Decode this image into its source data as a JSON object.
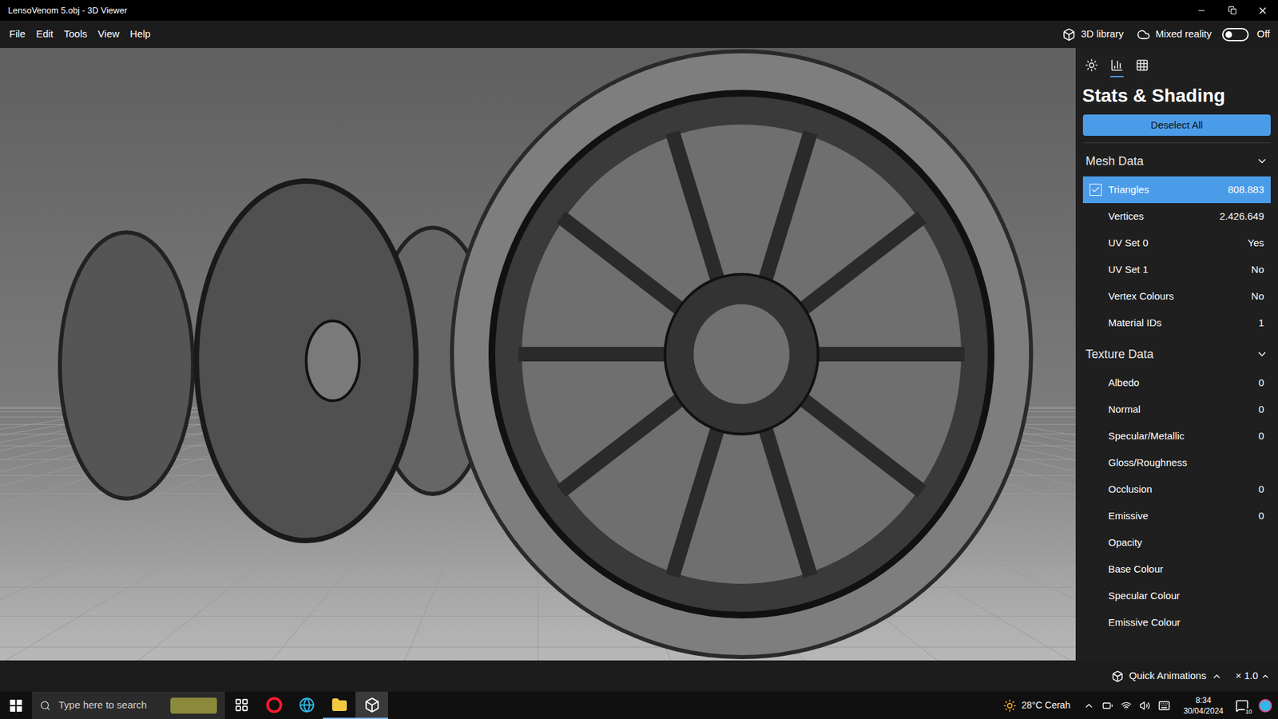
{
  "window": {
    "title": "LensoVenom 5.obj - 3D Viewer"
  },
  "menu": [
    "File",
    "Edit",
    "Tools",
    "View",
    "Help"
  ],
  "toolbar": {
    "library": "3D library",
    "mixed_reality": {
      "label": "Mixed reality",
      "on": false,
      "state_text": "Off"
    }
  },
  "panel": {
    "tabs": [
      {
        "name": "lighting",
        "selected": false
      },
      {
        "name": "stats",
        "selected": true
      },
      {
        "name": "grid",
        "selected": false
      }
    ],
    "title": "Stats & Shading",
    "deselect_button": "Deselect All",
    "sections": [
      {
        "title": "Mesh Data",
        "expanded": true,
        "rows": [
          {
            "label": "Triangles",
            "value": "808.883",
            "selected": true
          },
          {
            "label": "Vertices",
            "value": "2.426.649",
            "selected": false
          },
          {
            "label": "UV Set 0",
            "value": "Yes",
            "selected": false
          },
          {
            "label": "UV Set 1",
            "value": "No",
            "selected": false
          },
          {
            "label": "Vertex Colours",
            "value": "No",
            "selected": false
          },
          {
            "label": "Material IDs",
            "value": "1",
            "selected": false
          }
        ]
      },
      {
        "title": "Texture Data",
        "expanded": true,
        "rows": [
          {
            "label": "Albedo",
            "value": "0",
            "selected": false
          },
          {
            "label": "Normal",
            "value": "0",
            "selected": false
          },
          {
            "label": "Specular/Metallic",
            "value": "0",
            "selected": false
          },
          {
            "label": "Gloss/Roughness",
            "value": "",
            "selected": false
          },
          {
            "label": "Occlusion",
            "value": "0",
            "selected": false
          },
          {
            "label": "Emissive",
            "value": "0",
            "selected": false
          },
          {
            "label": "Opacity",
            "value": "",
            "selected": false
          },
          {
            "label": "Base Colour",
            "value": "",
            "selected": false
          },
          {
            "label": "Specular Colour",
            "value": "",
            "selected": false
          },
          {
            "label": "Emissive Colour",
            "value": "",
            "selected": false
          }
        ]
      }
    ]
  },
  "bottom_bar": {
    "animations": "Quick Animations",
    "speed": "× 1.0"
  },
  "taskbar": {
    "search_placeholder": "Type here to search",
    "apps": [
      {
        "name": "task-view",
        "running": false,
        "selected": false
      },
      {
        "name": "opera",
        "running": false,
        "selected": false
      },
      {
        "name": "edge",
        "running": false,
        "selected": false
      },
      {
        "name": "explorer",
        "running": true,
        "selected": false
      },
      {
        "name": "3d-viewer",
        "running": true,
        "selected": true
      }
    ],
    "weather": "28°C Cerah",
    "time": "8:34",
    "date": "30/04/2024",
    "notifications": "10"
  }
}
